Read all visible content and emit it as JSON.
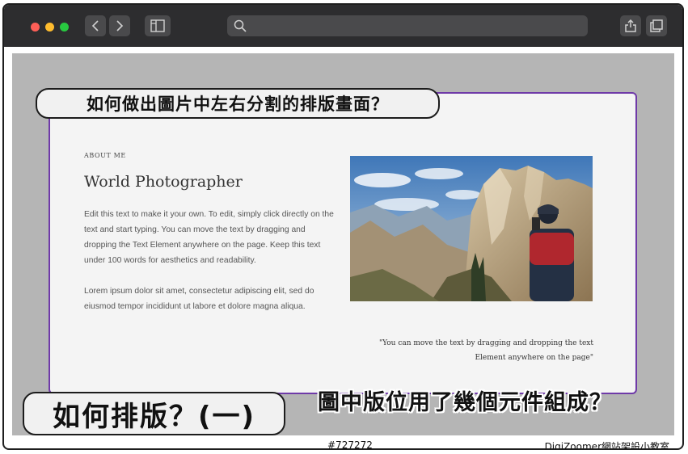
{
  "browser": {
    "icons": {
      "back": "chevron-left-icon",
      "forward": "chevron-right-icon",
      "sidebar": "sidebar-icon",
      "search": "search-icon",
      "share": "share-icon",
      "tabs": "tabs-icon"
    },
    "address_value": ""
  },
  "page": {
    "eyebrow": "ABOUT ME",
    "title": "World Photographer",
    "paragraph1": "Edit this text to make it your own. To edit, simply click directly on the text and start typing. You can move the text by dragging and dropping the Text Element anywhere on the page. Keep this text under 100 words for aesthetics and readability.",
    "paragraph2": "Lorem ipsum dolor sit amet, consectetur adipiscing elit, sed do eiusmod tempor incididunt ut labore et dolore magna aliqua.",
    "quote": "\"You can move the text by dragging and dropping the text Element anywhere on the page\"",
    "photo": "hiker-mountain-photo"
  },
  "overlay": {
    "top_label": "如何做出圖片中左右分割的排版畫面？",
    "bottom_label": "如何排版？(一)",
    "question": "圖中版位用了幾個元件組成？",
    "color_code": "#727272",
    "credit": "DigiZoomer網站架設小教室"
  },
  "colors": {
    "accent_border": "#6f3aa8",
    "background_gray": "#b5b5b5",
    "card_bg": "#f4f4f4",
    "titlebar": "#2d2d2f"
  }
}
